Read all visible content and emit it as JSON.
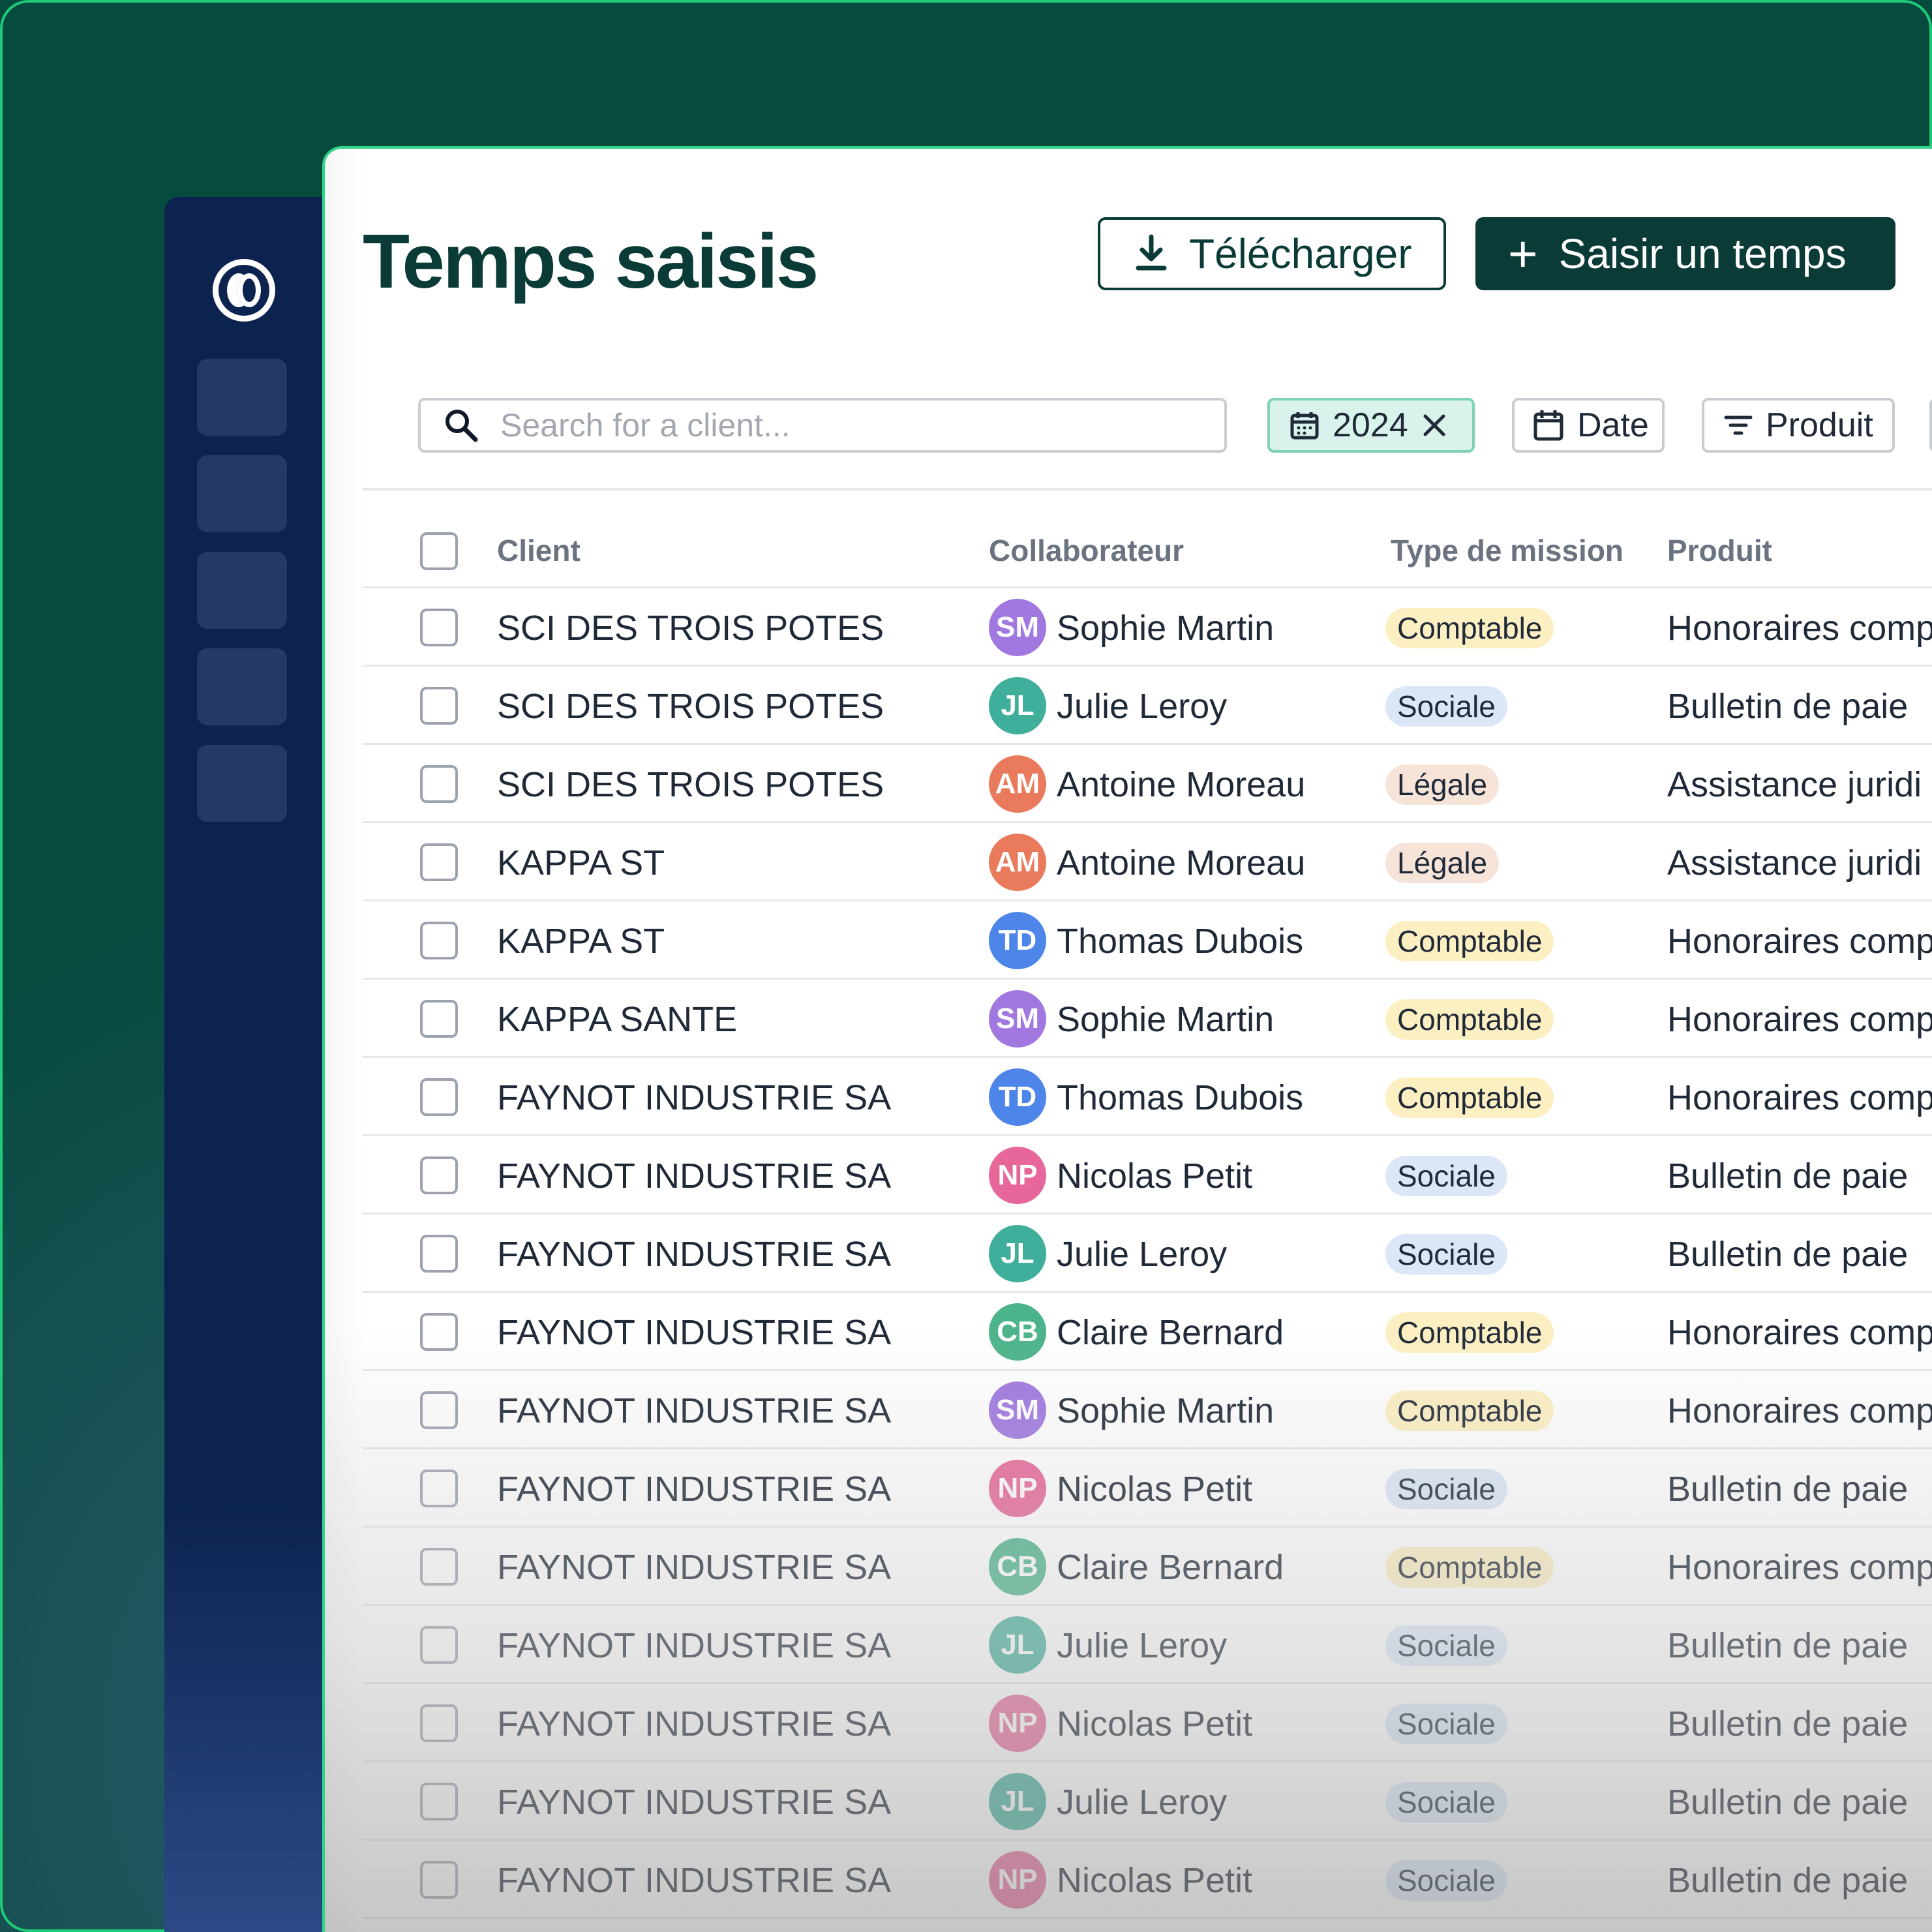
{
  "header": {
    "title": "Temps saisis",
    "download_label": "Télécharger",
    "add_label": "Saisir un temps"
  },
  "search": {
    "placeholder": "Search for a client..."
  },
  "filters": {
    "year": "2024",
    "date": "Date",
    "produit": "Produit"
  },
  "columns": {
    "client": "Client",
    "collaborateur": "Collaborateur",
    "type": "Type de mission",
    "produit": "Produit"
  },
  "rows": [
    {
      "client": "SCI DES TROIS POTES",
      "initials": "SM",
      "collab": "Sophie Martin",
      "type": "Comptable",
      "produit": "Honoraires comp"
    },
    {
      "client": "SCI DES TROIS POTES",
      "initials": "JL",
      "collab": "Julie Leroy",
      "type": "Sociale",
      "produit": "Bulletin de paie"
    },
    {
      "client": "SCI DES TROIS POTES",
      "initials": "AM",
      "collab": "Antoine Moreau",
      "type": "Légale",
      "produit": "Assistance juridi"
    },
    {
      "client": "KAPPA ST",
      "initials": "AM",
      "collab": "Antoine Moreau",
      "type": "Légale",
      "produit": "Assistance juridi"
    },
    {
      "client": "KAPPA ST",
      "initials": "TD",
      "collab": "Thomas Dubois",
      "type": "Comptable",
      "produit": "Honoraires comp"
    },
    {
      "client": "KAPPA SANTE",
      "initials": "SM",
      "collab": "Sophie Martin",
      "type": "Comptable",
      "produit": "Honoraires comp"
    },
    {
      "client": "FAYNOT INDUSTRIE SA",
      "initials": "TD",
      "collab": "Thomas Dubois",
      "type": "Comptable",
      "produit": "Honoraires comp"
    },
    {
      "client": "FAYNOT INDUSTRIE SA",
      "initials": "NP",
      "collab": "Nicolas Petit",
      "type": "Sociale",
      "produit": "Bulletin de paie"
    },
    {
      "client": "FAYNOT INDUSTRIE SA",
      "initials": "JL",
      "collab": "Julie Leroy",
      "type": "Sociale",
      "produit": "Bulletin de paie"
    },
    {
      "client": "FAYNOT INDUSTRIE SA",
      "initials": "CB",
      "collab": "Claire Bernard",
      "type": "Comptable",
      "produit": "Honoraires comp"
    },
    {
      "client": "FAYNOT INDUSTRIE SA",
      "initials": "SM",
      "collab": "Sophie Martin",
      "type": "Comptable",
      "produit": "Honoraires comp"
    },
    {
      "client": "FAYNOT INDUSTRIE SA",
      "initials": "NP",
      "collab": "Nicolas Petit",
      "type": "Sociale",
      "produit": "Bulletin de paie"
    },
    {
      "client": "FAYNOT INDUSTRIE SA",
      "initials": "CB",
      "collab": "Claire Bernard",
      "type": "Comptable",
      "produit": "Honoraires comp"
    },
    {
      "client": "FAYNOT INDUSTRIE SA",
      "initials": "JL",
      "collab": "Julie Leroy",
      "type": "Sociale",
      "produit": "Bulletin de paie"
    },
    {
      "client": "FAYNOT INDUSTRIE SA",
      "initials": "NP",
      "collab": "Nicolas Petit",
      "type": "Sociale",
      "produit": "Bulletin de paie"
    },
    {
      "client": "FAYNOT INDUSTRIE SA",
      "initials": "JL",
      "collab": "Julie Leroy",
      "type": "Sociale",
      "produit": "Bulletin de paie"
    },
    {
      "client": "FAYNOT INDUSTRIE SA",
      "initials": "NP",
      "collab": "Nicolas Petit",
      "type": "Sociale",
      "produit": "Bulletin de paie"
    }
  ],
  "avatar_colors": {
    "SM": "#a078e0",
    "JL": "#3fae9a",
    "AM": "#e97a5c",
    "TD": "#4d86e8",
    "NP": "#e8679b",
    "CB": "#4cb48a"
  },
  "colors": {
    "brand_dark": "#0b3b37",
    "sidebar": "#0c2350",
    "accent_green": "#1fcb78"
  }
}
